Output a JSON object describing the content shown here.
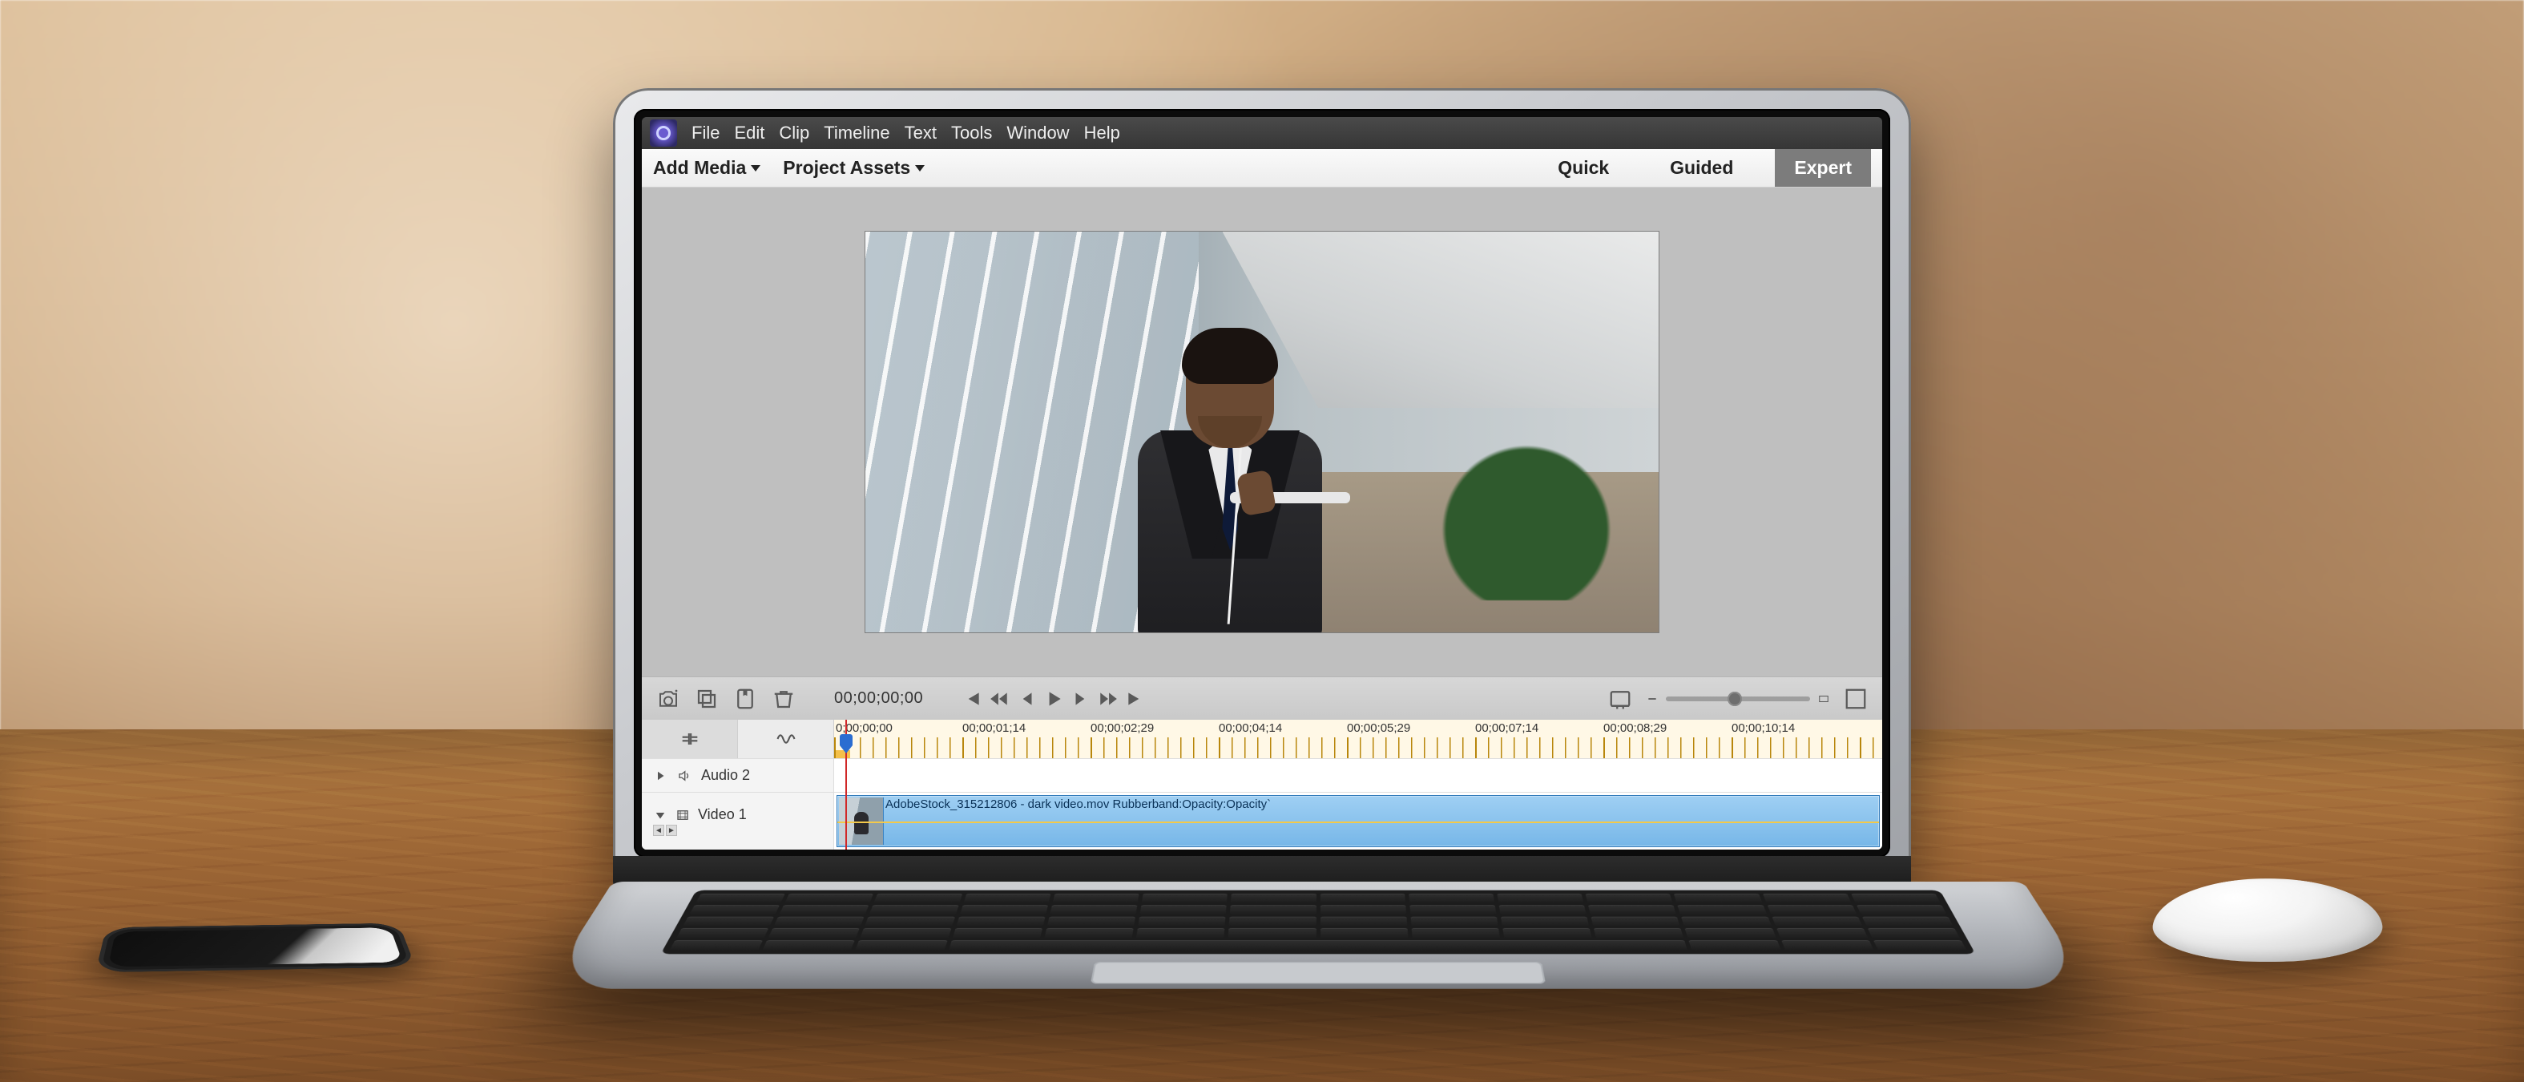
{
  "menubar": {
    "items": [
      "File",
      "Edit",
      "Clip",
      "Timeline",
      "Text",
      "Tools",
      "Window",
      "Help"
    ]
  },
  "modebar": {
    "add_media": "Add Media",
    "project_assets": "Project Assets",
    "tabs": {
      "quick": "Quick",
      "guided": "Guided",
      "expert": "Expert"
    },
    "active_tab": "Expert"
  },
  "transport": {
    "timecode": "00;00;00;00"
  },
  "ruler": {
    "labels": [
      "0;00;00;00",
      "00;00;01;14",
      "00;00;02;29",
      "00;00;04;14",
      "00;00;05;29",
      "00;00;07;14",
      "00;00;08;29",
      "00;00;10;14"
    ]
  },
  "tracks": {
    "audio2": {
      "name": "Audio 2"
    },
    "video1": {
      "name": "Video 1",
      "clip_label": "AdobeStock_315212806 - dark video.mov Rubberband:Opacity:Opacity`"
    }
  }
}
